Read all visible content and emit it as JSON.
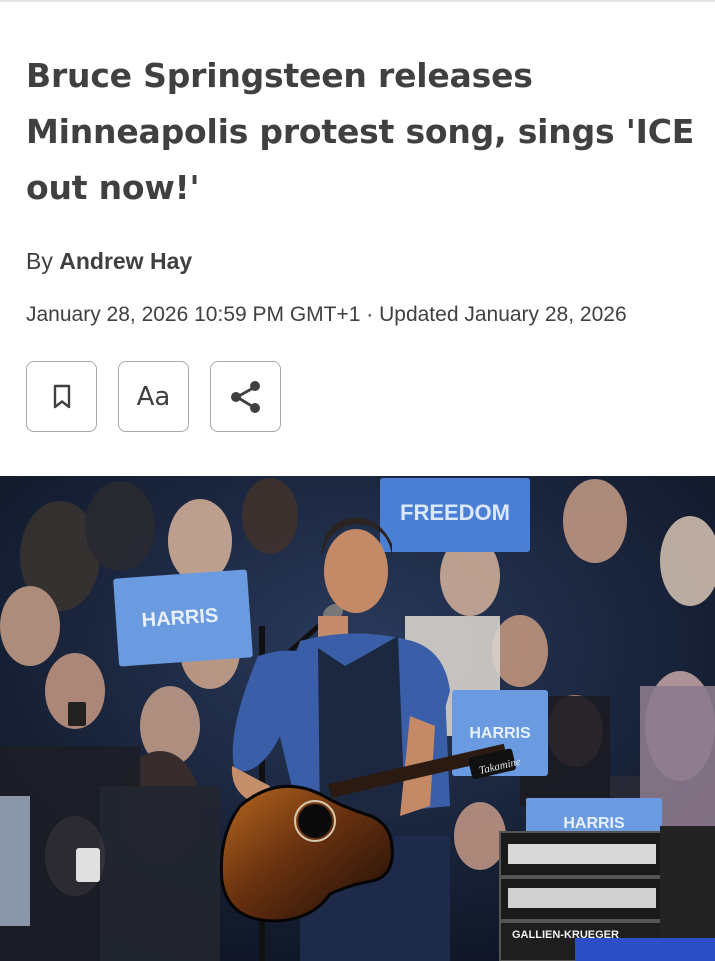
{
  "article": {
    "headline": "Bruce Springsteen releases Minneapolis protest song, sings 'ICE out now!'",
    "byline_prefix": "By",
    "author": "Andrew Hay",
    "dateline": "January 28, 2026 10:59 PM GMT+1 · Updated January 28, 2026"
  },
  "toolbar": {
    "bookmark_icon": "bookmark-icon",
    "text_size_label": "Aa",
    "share_icon": "share-icon"
  },
  "photo": {
    "sign_texts": [
      "FREEDOM",
      "HARRIS",
      "HARRIS",
      "HARRIS"
    ],
    "amp_label": "GALLIEN-KRUEGER",
    "guitar_brand": "Takamine"
  },
  "colors": {
    "text": "#404040",
    "border": "#a8a8a8",
    "sign_blue": "#4a7fd4",
    "shirt_blue": "#3a5fa8"
  }
}
